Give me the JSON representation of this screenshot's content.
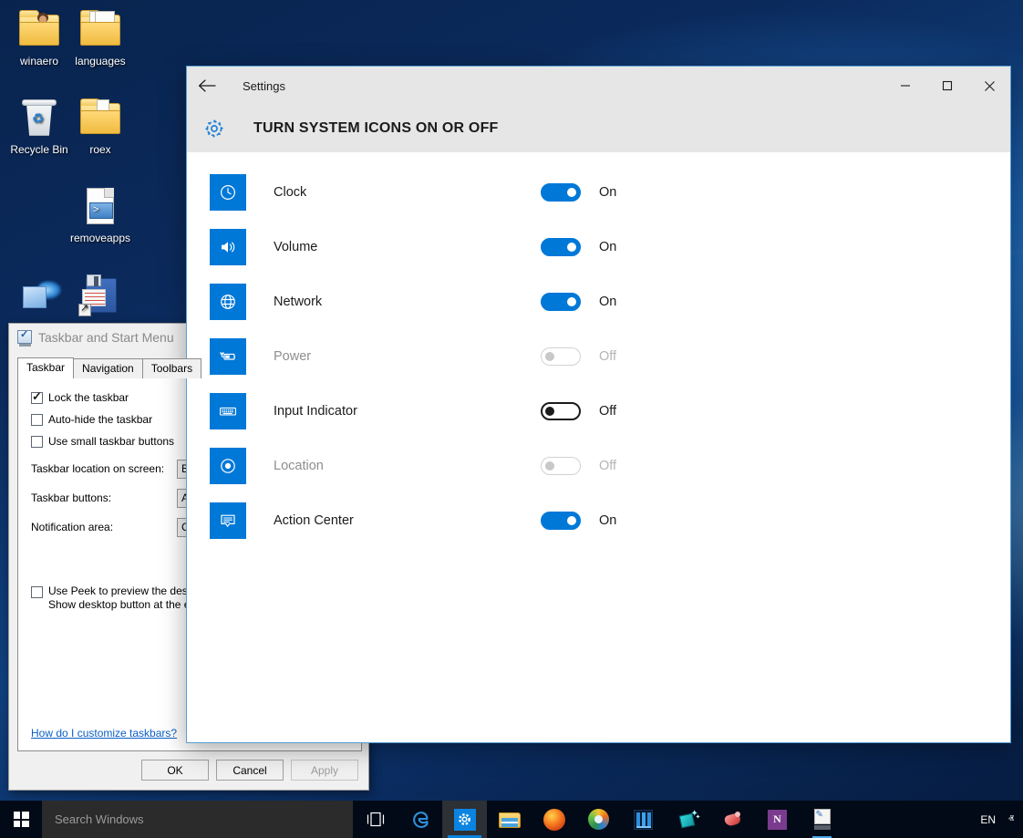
{
  "desktop": {
    "icons": [
      {
        "label": "winaero",
        "icon": "folder-user-icon"
      },
      {
        "label": "languages",
        "icon": "folder-documents-icon"
      },
      {
        "label": "Recycle Bin",
        "icon": "recycle-bin-icon"
      },
      {
        "label": "roex",
        "icon": "folder-icon"
      },
      {
        "label": "removeapps",
        "icon": "powershell-script-icon"
      },
      {
        "label": "",
        "icon": "blue-tile-icon"
      },
      {
        "label": "",
        "icon": "floppy-shortcut-icon"
      }
    ]
  },
  "taskbar_dialog": {
    "title": "Taskbar and Start Menu",
    "title_icon": "taskbar-properties-icon",
    "tabs": [
      {
        "label": "Taskbar",
        "active": true
      },
      {
        "label": "Navigation",
        "active": false
      },
      {
        "label": "Toolbars",
        "active": false
      }
    ],
    "checkboxes": [
      {
        "label": "Lock the taskbar",
        "checked": true
      },
      {
        "label": "Auto-hide the taskbar",
        "checked": false
      },
      {
        "label": "Use small taskbar buttons",
        "checked": false
      }
    ],
    "fields": [
      {
        "label": "Taskbar location on screen:",
        "value": "Bottom"
      },
      {
        "label": "Taskbar buttons:",
        "value": "Always combine, hide labels"
      },
      {
        "label": "Notification area:",
        "value": "Customize..."
      }
    ],
    "peek": {
      "checked": false,
      "line1": "Use Peek to preview the desktop when you move your mouse to the",
      "line2": "Show desktop button at the end of the taskbar"
    },
    "help_link": "How do I customize taskbars?",
    "buttons": [
      {
        "label": "OK",
        "disabled": false
      },
      {
        "label": "Cancel",
        "disabled": false
      },
      {
        "label": "Apply",
        "disabled": true
      }
    ]
  },
  "settings": {
    "window_title": "Settings",
    "back_icon": "back-arrow-icon",
    "gear_icon": "gear-icon",
    "page_title": "TURN SYSTEM ICONS ON OR OFF",
    "window_controls": [
      {
        "name": "minimize",
        "glyph": "—"
      },
      {
        "name": "maximize",
        "glyph": "□"
      },
      {
        "name": "close",
        "glyph": "✕"
      }
    ],
    "accent_color": "#0078d7",
    "rows": [
      {
        "name": "Clock",
        "icon": "clock-icon",
        "state": "On",
        "on": true,
        "disabled": false,
        "focused": false
      },
      {
        "name": "Volume",
        "icon": "volume-icon",
        "state": "On",
        "on": true,
        "disabled": false,
        "focused": false
      },
      {
        "name": "Network",
        "icon": "network-globe-icon",
        "state": "On",
        "on": true,
        "disabled": false,
        "focused": false
      },
      {
        "name": "Power",
        "icon": "power-battery-icon",
        "state": "Off",
        "on": false,
        "disabled": true,
        "focused": false
      },
      {
        "name": "Input Indicator",
        "icon": "keyboard-icon",
        "state": "Off",
        "on": false,
        "disabled": false,
        "focused": true
      },
      {
        "name": "Location",
        "icon": "location-target-icon",
        "state": "Off",
        "on": false,
        "disabled": true,
        "focused": false
      },
      {
        "name": "Action Center",
        "icon": "action-center-icon",
        "state": "On",
        "on": true,
        "disabled": false,
        "focused": false
      }
    ]
  },
  "system_taskbar": {
    "start_icon": "windows-start-icon",
    "search_placeholder": "Search Windows",
    "apps": [
      {
        "name": "task-view-icon",
        "active": false,
        "running": false
      },
      {
        "name": "edge-browser-icon",
        "active": false,
        "running": false
      },
      {
        "name": "settings-app-icon",
        "active": true,
        "running": false
      },
      {
        "name": "file-explorer-icon",
        "active": false,
        "running": false
      },
      {
        "name": "firefox-icon",
        "active": false,
        "running": false
      },
      {
        "name": "chrome-icon",
        "active": false,
        "running": false
      },
      {
        "name": "spreadsheet-icon",
        "active": false,
        "running": false
      },
      {
        "name": "winaero-tweaker-icon",
        "active": false,
        "running": false
      },
      {
        "name": "meat-icon",
        "active": false,
        "running": false
      },
      {
        "name": "onenote-icon",
        "active": false,
        "running": false
      },
      {
        "name": "script-window-icon",
        "active": false,
        "running": true
      }
    ],
    "tray": {
      "language": "EN",
      "chevron": "ⱏ"
    }
  }
}
